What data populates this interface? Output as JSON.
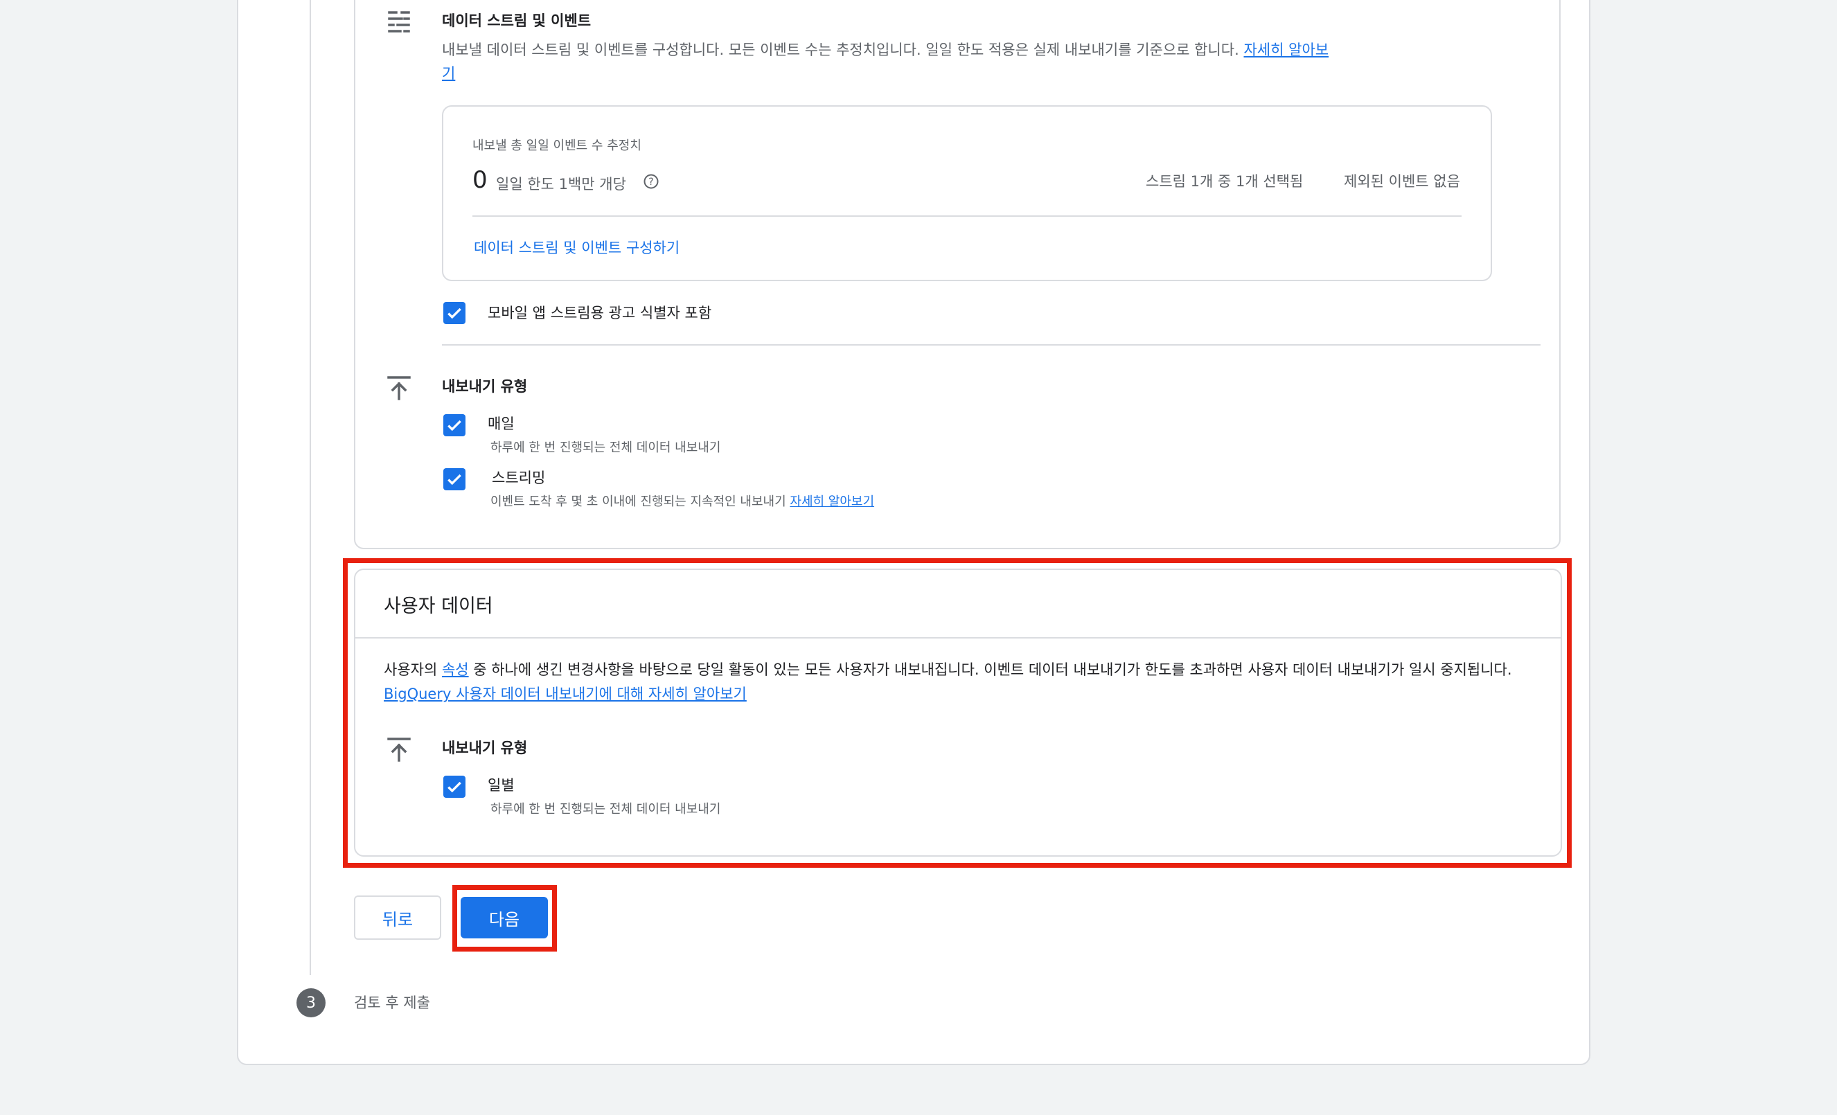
{
  "data_stream_section": {
    "title": "데이터 스트림 및 이벤트",
    "desc_line1": "내보낼 데이터 스트림 및 이벤트를 구성합니다. 모든 이벤트 수는 추정치입니다. 일일 한도 적용은 실제 내보내기를 기준으로 합니다.",
    "learn_more_part1": "자세히 알아보",
    "learn_more_part2": "기",
    "estimate_label": "내보낼 총 일일 이벤트 수 추정치",
    "estimate_value": "0",
    "daily_limit": "일일 한도 1백만 개당",
    "streams_selected": "스트림 1개 중 1개 선택됨",
    "excluded_events": "제외된 이벤트 없음",
    "configure_link": "데이터 스트림 및 이벤트 구성하기",
    "include_ad_id_label": "모바일 앱 스트림용 광고 식별자 포함",
    "include_ad_id_checked": true
  },
  "export_type_section": {
    "title": "내보내기 유형",
    "daily_label": "매일",
    "daily_desc": "하루에 한 번 진행되는 전체 데이터 내보내기",
    "daily_checked": true,
    "streaming_label": "스트리밍",
    "streaming_desc": "이벤트 도착 후 몇 초 이내에 진행되는 지속적인 내보내기",
    "streaming_learn_more": "자세히 알아보기",
    "streaming_checked": true
  },
  "user_data_section": {
    "title": "사용자 데이터",
    "desc_part1": "사용자의 ",
    "desc_link_property": "속성",
    "desc_part2": " 중 하나에 생긴 변경사항을 바탕으로 당일 활동이 있는 모든 사용자가 내보내집니다. 이벤트 데이터 내보내기가 한도를 초과하면 사용자 데이터 내보내기가 일시 중지됩니다. ",
    "desc_link_bigquery": "BigQuery 사용자 데이터 내보내기에 대해 자세히 알아보기",
    "export_type_title": "내보내기 유형",
    "daily_label": "일별",
    "daily_desc": "하루에 한 번 진행되는 전체 데이터 내보내기",
    "daily_checked": true
  },
  "buttons": {
    "back": "뒤로",
    "next": "다음"
  },
  "step3": {
    "number": "3",
    "label": "검토 후 제출"
  },
  "colors": {
    "accent": "#1a73e8",
    "highlight": "#e8210f",
    "border": "#dadce0",
    "background": "#f1f3f4"
  },
  "icons": {
    "data_stream": "tune-lines-icon",
    "export": "upload-arrow-icon",
    "help": "help-circle-icon",
    "check": "check-icon"
  }
}
